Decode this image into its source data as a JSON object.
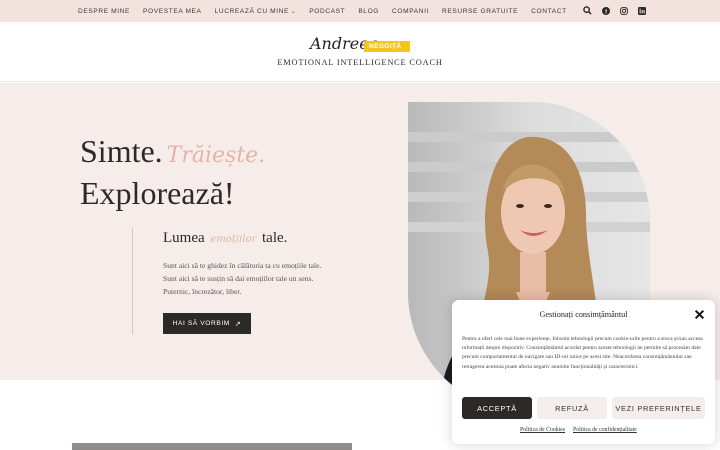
{
  "nav": {
    "items": [
      "DESPRE MINE",
      "POVESTEA MEA",
      "LUCREAZĂ CU MINE",
      "PODCAST",
      "BLOG",
      "COMPANII",
      "RESURSE GRATUITE",
      "CONTACT"
    ],
    "dropdown_caret": "⌄"
  },
  "social_icons": [
    "search-icon",
    "facebook-icon",
    "instagram-icon",
    "linkedin-icon"
  ],
  "logo": {
    "script_name": "Andreea",
    "tag": "NEGOIȚĂ",
    "subtitle": "EMOTIONAL INTELLIGENCE COACH"
  },
  "hero": {
    "line1_main": "Simte.",
    "line1_accent": "Trăiește.",
    "line2": "Explorează!",
    "subhead_before": "Lumea",
    "subhead_accent": "emoțiilor",
    "subhead_after": "tale.",
    "body_lines": [
      "Sunt aici să te ghidez în călătoria ta cu emoțiile tale.",
      "Sunt aici să te susțin să dai emoțiilor tale un sens.",
      "Puternic, încrezător, liber."
    ],
    "cta_label": "HAI SĂ VORBIM",
    "cta_icon": "arrow-up-right-icon"
  },
  "consent": {
    "title": "Gestionați consimțământul",
    "text": "Pentru a oferi cele mai bune experiențe, folosim tehnologii precum cookie-urile pentru a stoca și/sau accesa informații despre dispozitiv. Consimțământul acordat pentru aceste tehnologii ne permite să procesăm date precum comportamentul de navigare sau ID-uri unice pe acest site. Neacordarea consimțământului sau retragerea acestuia poate afecta negativ anumite funcționalități și caracteristici.",
    "accept": "ACCEPTĂ",
    "refuse": "REFUZĂ",
    "preferences": "VEZI PREFERINȚELE",
    "cookie_policy": "Politica de Cookies",
    "privacy_policy": "Politica de confidențialitate"
  },
  "colors": {
    "topbar": "#f3e3de",
    "hero_bg": "#f6ece9",
    "accent": "#e7b3a7",
    "tag": "#f4c51f",
    "button_dark": "#2c2a29"
  }
}
